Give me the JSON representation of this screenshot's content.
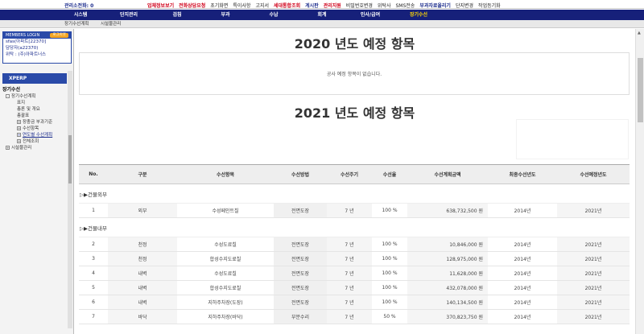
{
  "topbar": {
    "calls": "관리소전화: 0",
    "links": [
      {
        "label": "업체정보보기",
        "style": "red"
      },
      {
        "label": "전화상담요청",
        "style": "red"
      },
      {
        "label": "초기화면",
        "style": ""
      },
      {
        "label": "특이사항",
        "style": ""
      },
      {
        "label": "고지서",
        "style": ""
      },
      {
        "label": "세대통합조회",
        "style": "red"
      },
      {
        "label": "게시판",
        "style": "blue"
      },
      {
        "label": "관리지원",
        "style": "red"
      },
      {
        "label": "비밀번호변경",
        "style": ""
      },
      {
        "label": "위탁사",
        "style": ""
      },
      {
        "label": "SMS전송",
        "style": ""
      },
      {
        "label": "부과자료올리기",
        "style": "blue"
      },
      {
        "label": "단지변경",
        "style": ""
      },
      {
        "label": "작업등기화",
        "style": ""
      }
    ]
  },
  "mainnav": [
    "시스템",
    "단지관리",
    "검침",
    "부과",
    "수납",
    "회계",
    "인사/급여",
    "장기수선"
  ],
  "subnav": [
    "장기수선계획",
    "시설물관리"
  ],
  "login": {
    "header": "MEMBERS LOGIN",
    "logout": "로그아웃",
    "lines": [
      "sfas(아파트[22370]",
      "담당자(a22370)",
      "위탁 : (주)아파트너스"
    ]
  },
  "sidebar": {
    "xperp": "XPERP",
    "tree": [
      {
        "label": "장기수선",
        "level": "root",
        "pm": ""
      },
      {
        "label": "장기수선계획",
        "level": "l1",
        "pm": "-"
      },
      {
        "label": "표지",
        "level": "l2",
        "pm": ""
      },
      {
        "label": "총론 및 개요",
        "level": "l2",
        "pm": ""
      },
      {
        "label": "총괄표",
        "level": "l2",
        "pm": ""
      },
      {
        "label": "장충금 부과기준",
        "level": "l2",
        "pm": "+"
      },
      {
        "label": "수선항목",
        "level": "l2",
        "pm": "+"
      },
      {
        "label": "연도별 수선계획",
        "level": "l2",
        "pm": "+",
        "selected": true
      },
      {
        "label": "전체조회",
        "level": "l2",
        "pm": "+"
      },
      {
        "label": "시설물관리",
        "level": "l1",
        "pm": "+"
      }
    ]
  },
  "content": {
    "title2020": "2020 년도 예정 항목",
    "empty_msg": "공사 예정 항목이 없습니다.",
    "title2021": "2021 년도 예정 항목",
    "columns": [
      "No.",
      "구분",
      "수선항목",
      "수선방법",
      "수선주기",
      "수선율",
      "수선계획금액",
      "최종수선년도",
      "수선예정년도"
    ],
    "groups": [
      {
        "label": "▷▶건물외부",
        "rows": [
          {
            "no": "1",
            "cat": "외부",
            "item": "수성페인트칠",
            "method": "전면도장",
            "cycle": "7 년",
            "rate": "100 %",
            "amount": "638,732,500 원",
            "last": "2014년",
            "plan": "2021년"
          }
        ]
      },
      {
        "label": "▷▶건물내부",
        "rows": [
          {
            "no": "2",
            "cat": "천정",
            "item": "수성도료칠",
            "method": "전면도장",
            "cycle": "7 년",
            "rate": "100 %",
            "amount": "10,846,000 원",
            "last": "2014년",
            "plan": "2021년"
          },
          {
            "no": "3",
            "cat": "천정",
            "item": "합성수지도료칠",
            "method": "전면도장",
            "cycle": "7 년",
            "rate": "100 %",
            "amount": "128,975,000 원",
            "last": "2014년",
            "plan": "2021년"
          },
          {
            "no": "4",
            "cat": "내벽",
            "item": "수성도료칠",
            "method": "전면도장",
            "cycle": "7 년",
            "rate": "100 %",
            "amount": "11,628,000 원",
            "last": "2014년",
            "plan": "2021년"
          },
          {
            "no": "5",
            "cat": "내벽",
            "item": "합성수지도료칠",
            "method": "전면도장",
            "cycle": "7 년",
            "rate": "100 %",
            "amount": "432,078,000 원",
            "last": "2014년",
            "plan": "2021년"
          },
          {
            "no": "6",
            "cat": "내벽",
            "item": "지하주차장(도장)",
            "method": "전면도장",
            "cycle": "7 년",
            "rate": "100 %",
            "amount": "140,134,500 원",
            "last": "2014년",
            "plan": "2021년"
          },
          {
            "no": "7",
            "cat": "바닥",
            "item": "지하주차장(바닥)",
            "method": "부분수리",
            "cycle": "7 년",
            "rate": "50 %",
            "amount": "370,823,750 원",
            "last": "2014년",
            "plan": "2021년"
          }
        ]
      }
    ]
  }
}
